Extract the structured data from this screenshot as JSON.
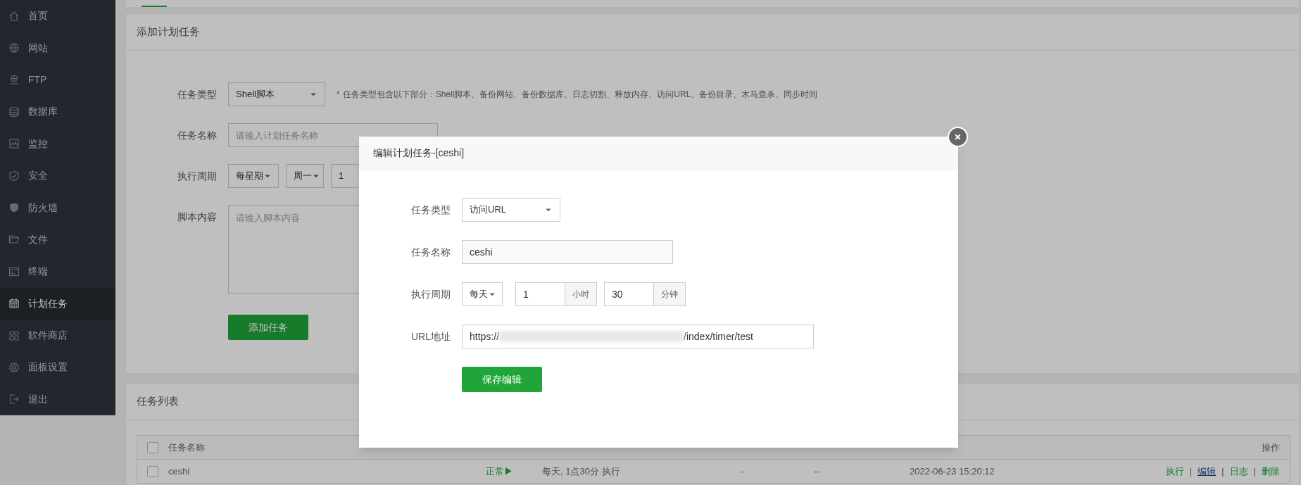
{
  "sidebar": {
    "items": [
      {
        "label": "首页",
        "selected": false
      },
      {
        "label": "网站",
        "selected": false
      },
      {
        "label": "FTP",
        "selected": false
      },
      {
        "label": "数据库",
        "selected": false
      },
      {
        "label": "监控",
        "selected": false
      },
      {
        "label": "安全",
        "selected": false
      },
      {
        "label": "防火墙",
        "selected": false
      },
      {
        "label": "文件",
        "selected": false
      },
      {
        "label": "终端",
        "selected": false
      },
      {
        "label": "计划任务",
        "selected": true
      },
      {
        "label": "软件商店",
        "selected": false
      },
      {
        "label": "面板设置",
        "selected": false
      },
      {
        "label": "退出",
        "selected": false
      }
    ]
  },
  "add_task": {
    "title": "添加计划任务",
    "rows": [
      {
        "kind": "select",
        "label": "任务类型",
        "value": "Shell脚本",
        "note_mark": "*",
        "note": "任务类型包含以下部分：Shell脚本、备份网站、备份数据库、日志切割、释放内存、访问URL、备份目录、木马查杀、同步时间"
      },
      {
        "kind": "text",
        "label": "任务名称",
        "placeholder": "请输入计划任务名称"
      },
      {
        "kind": "period",
        "label": "执行周期",
        "selects": [
          "每星期",
          "周一",
          "1"
        ]
      },
      {
        "kind": "textarea",
        "label": "脚本内容",
        "placeholder": "请输入脚本内容"
      }
    ],
    "button": "添加任务"
  },
  "task_list": {
    "title": "任务列表",
    "header_checked": false,
    "columns": [
      "任务名称",
      "操作"
    ],
    "rows": [
      {
        "checked": false,
        "name": "ceshi",
        "status": "正常▶",
        "cycle": "每天, 1点30分 执行",
        "save_count": "-",
        "backup_to": "--",
        "last_run": "2022-06-23 15:20:12",
        "actions": [
          {
            "label": "执行",
            "hovered": false
          },
          {
            "label": "编辑",
            "hovered": true
          },
          {
            "label": "日志",
            "hovered": false
          },
          {
            "label": "删除",
            "hovered": false
          }
        ],
        "separator": "|"
      }
    ]
  },
  "modal": {
    "title": "编辑计划任务-[ceshi]",
    "rows": [
      {
        "kind": "select",
        "label": "任务类型",
        "value": "访问URL"
      },
      {
        "kind": "text",
        "label": "任务名称",
        "value": "ceshi"
      },
      {
        "kind": "period",
        "label": "执行周期",
        "select": "每天",
        "inputs": [
          {
            "value": "1",
            "unit": "小时"
          },
          {
            "value": "30",
            "unit": "分钟"
          }
        ]
      },
      {
        "kind": "url",
        "label": "URL地址",
        "prefix": "https://",
        "redacted": true,
        "suffix": "/index/timer/test"
      }
    ],
    "button": "保存编辑"
  }
}
